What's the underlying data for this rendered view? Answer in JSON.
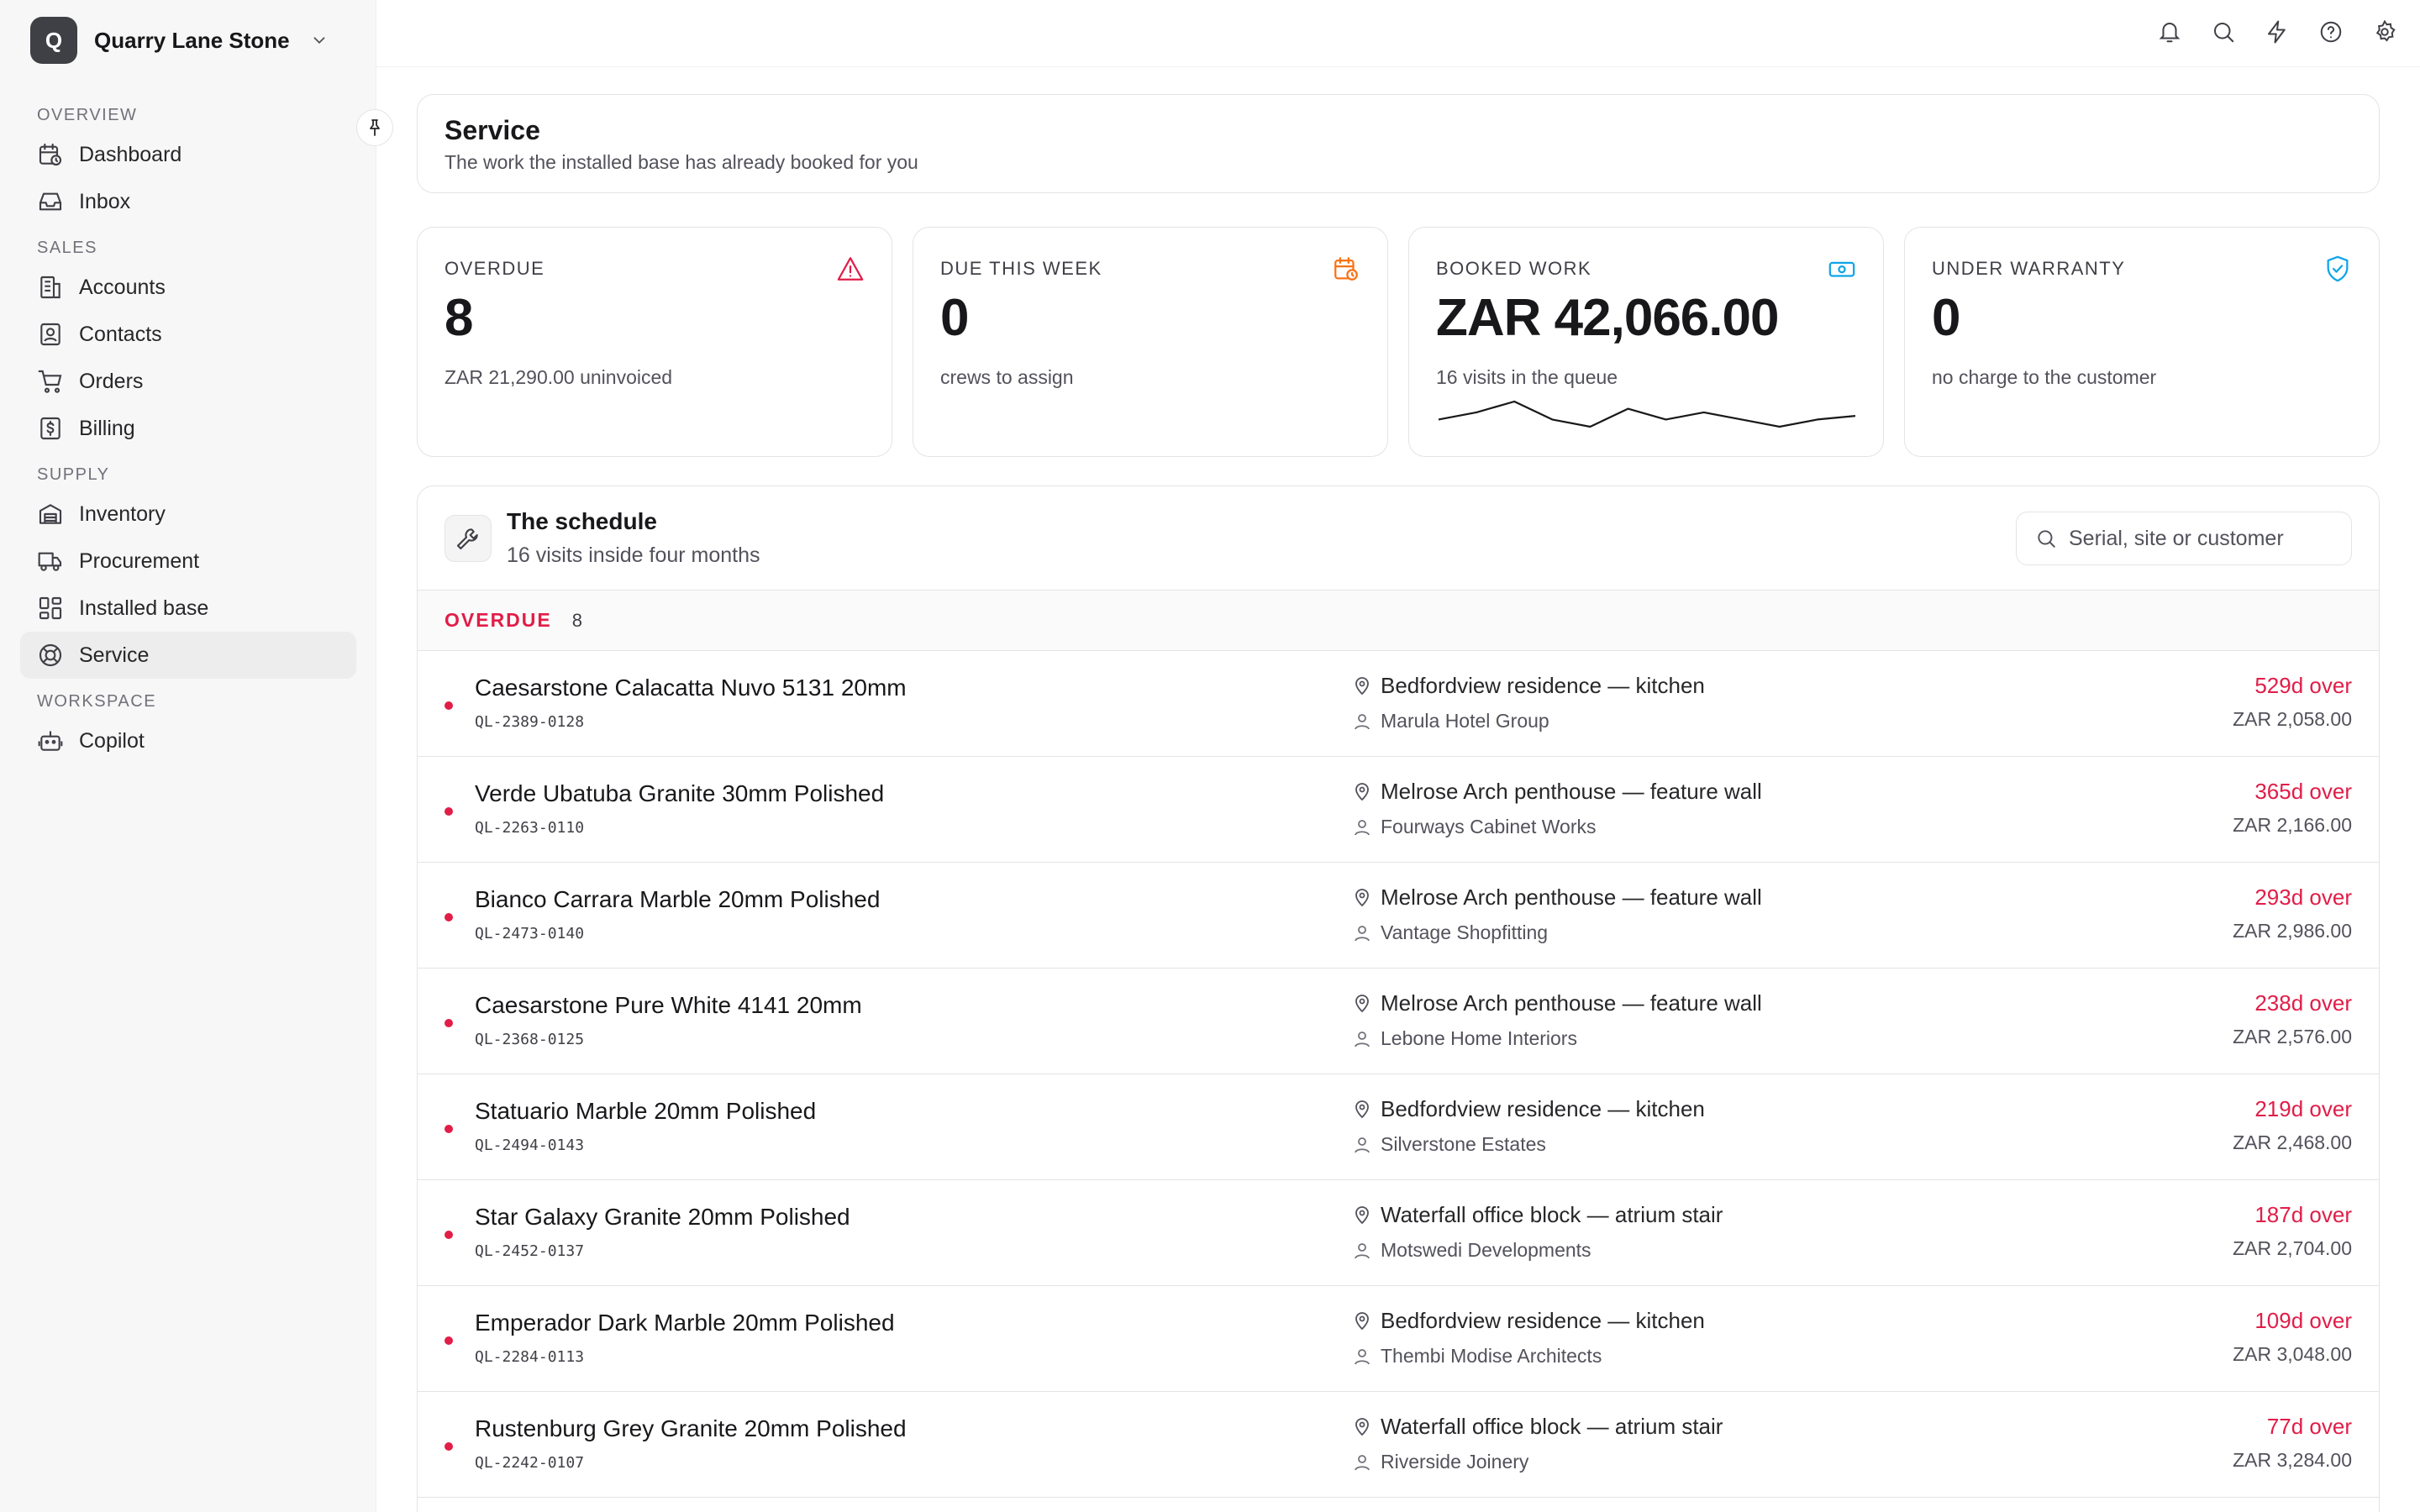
{
  "org": {
    "initial": "Q",
    "name": "Quarry Lane Stone"
  },
  "nav": {
    "sections": [
      {
        "label": "OVERVIEW",
        "items": [
          {
            "label": "Dashboard",
            "icon": "calendar-clock-icon"
          },
          {
            "label": "Inbox",
            "icon": "inbox-icon"
          }
        ]
      },
      {
        "label": "SALES",
        "items": [
          {
            "label": "Accounts",
            "icon": "building-icon"
          },
          {
            "label": "Contacts",
            "icon": "contact-card-icon"
          },
          {
            "label": "Orders",
            "icon": "cart-icon"
          },
          {
            "label": "Billing",
            "icon": "dollar-doc-icon"
          }
        ]
      },
      {
        "label": "SUPPLY",
        "items": [
          {
            "label": "Inventory",
            "icon": "warehouse-icon"
          },
          {
            "label": "Procurement",
            "icon": "truck-icon"
          },
          {
            "label": "Installed base",
            "icon": "grid-icon"
          },
          {
            "label": "Service",
            "icon": "lifebuoy-icon",
            "active": true
          }
        ]
      },
      {
        "label": "WORKSPACE",
        "items": [
          {
            "label": "Copilot",
            "icon": "bot-icon"
          }
        ]
      }
    ]
  },
  "header": {
    "title": "Service",
    "subtitle": "The work the installed base has already booked for you"
  },
  "kpis": [
    {
      "label": "OVERDUE",
      "value": "8",
      "sub": "ZAR 21,290.00 uninvoiced",
      "icon": "warning-icon",
      "color": "#e11d48"
    },
    {
      "label": "DUE THIS WEEK",
      "value": "0",
      "sub": "crews to assign",
      "icon": "calendar-clock-icon",
      "color": "#f97316"
    },
    {
      "label": "BOOKED WORK",
      "value": "ZAR 42,066.00",
      "sub": "16 visits in the queue",
      "icon": "banknote-icon",
      "color": "#0ea5e9"
    },
    {
      "label": "UNDER WARRANTY",
      "value": "0",
      "sub": "no charge to the customer",
      "icon": "shield-check-icon",
      "color": "#0ea5e9"
    }
  ],
  "sparkline": [
    6,
    8,
    11,
    6,
    4,
    9,
    6,
    8,
    6,
    4,
    6,
    7
  ],
  "schedule": {
    "title": "The schedule",
    "subtitle": "16 visits inside four months",
    "search_placeholder": "Serial, site or customer",
    "group": {
      "label": "OVERDUE",
      "count": "8"
    },
    "rows": [
      {
        "product": "Caesarstone Calacatta Nuvo 5131 20mm",
        "serial": "QL-2389-0128",
        "site": "Bedfordview residence — kitchen",
        "customer": "Marula Hotel Group",
        "over": "529d over",
        "amount": "ZAR 2,058.00"
      },
      {
        "product": "Verde Ubatuba Granite 30mm Polished",
        "serial": "QL-2263-0110",
        "site": "Melrose Arch penthouse — feature wall",
        "customer": "Fourways Cabinet Works",
        "over": "365d over",
        "amount": "ZAR 2,166.00"
      },
      {
        "product": "Bianco Carrara Marble 20mm Polished",
        "serial": "QL-2473-0140",
        "site": "Melrose Arch penthouse — feature wall",
        "customer": "Vantage Shopfitting",
        "over": "293d over",
        "amount": "ZAR 2,986.00"
      },
      {
        "product": "Caesarstone Pure White 4141 20mm",
        "serial": "QL-2368-0125",
        "site": "Melrose Arch penthouse — feature wall",
        "customer": "Lebone Home Interiors",
        "over": "238d over",
        "amount": "ZAR 2,576.00"
      },
      {
        "product": "Statuario Marble 20mm Polished",
        "serial": "QL-2494-0143",
        "site": "Bedfordview residence — kitchen",
        "customer": "Silverstone Estates",
        "over": "219d over",
        "amount": "ZAR 2,468.00"
      },
      {
        "product": "Star Galaxy Granite 20mm Polished",
        "serial": "QL-2452-0137",
        "site": "Waterfall office block — atrium stair",
        "customer": "Motswedi Developments",
        "over": "187d over",
        "amount": "ZAR 2,704.00"
      },
      {
        "product": "Emperador Dark Marble 20mm Polished",
        "serial": "QL-2284-0113",
        "site": "Bedfordview residence — kitchen",
        "customer": "Thembi Modise Architects",
        "over": "109d over",
        "amount": "ZAR 3,048.00"
      },
      {
        "product": "Rustenburg Grey Granite 20mm Polished",
        "serial": "QL-2242-0107",
        "site": "Waterfall office block — atrium stair",
        "customer": "Riverside Joinery",
        "over": "77d over",
        "amount": "ZAR 3,284.00"
      }
    ]
  }
}
